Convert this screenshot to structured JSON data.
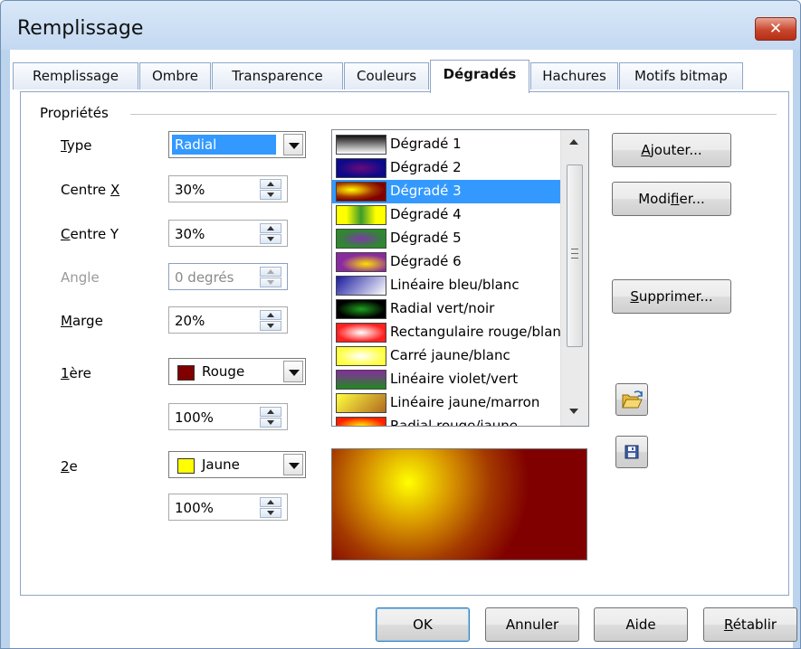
{
  "window": {
    "title": "Remplissage",
    "close_label": "✕"
  },
  "tabs": [
    {
      "label": "Remplissage"
    },
    {
      "label": "Ombre"
    },
    {
      "label": "Transparence"
    },
    {
      "label": "Couleurs"
    },
    {
      "label": "Dégradés",
      "active": true
    },
    {
      "label": "Hachures"
    },
    {
      "label": "Motifs bitmap"
    }
  ],
  "properties": {
    "group_label": "Propriétés",
    "type": {
      "label_pre": "",
      "label_u": "T",
      "label_post": "ype",
      "value": "Radial"
    },
    "centre_x": {
      "label_pre": "Centre ",
      "label_u": "X",
      "label_post": "",
      "value": "30%"
    },
    "centre_y": {
      "label_pre": "",
      "label_u": "C",
      "label_post": "entre Y",
      "value": "30%"
    },
    "angle": {
      "label": "Angle",
      "value": "0 degrés",
      "disabled": true
    },
    "marge": {
      "label_pre": "",
      "label_u": "M",
      "label_post": "arge",
      "value": "20%"
    },
    "first": {
      "label_pre": "",
      "label_u": "1",
      "label_post": "ère",
      "color_name": "Rouge",
      "color": "#800000",
      "intensity": "100%"
    },
    "second": {
      "label_pre": "",
      "label_u": "2",
      "label_post": "e",
      "color_name": "Jaune",
      "color": "#ffff00",
      "intensity": "100%"
    }
  },
  "gradients": [
    {
      "name": "Dégradé 1",
      "swatch": "linear-gradient(#111,#888 50%,#fff)"
    },
    {
      "name": "Dégradé 2",
      "swatch": "radial-gradient(ellipse at center,#6a0a7a,#0a0a8a 70%)"
    },
    {
      "name": "Dégradé 3",
      "swatch": "radial-gradient(ellipse at 30% 40%,#ffff00,#d89500 25%,#a43a00 45%,#800000 70%)",
      "selected": true
    },
    {
      "name": "Dégradé 4",
      "swatch": "linear-gradient(90deg,#ffff00 20%,#3c9a2a 50%,#ffff00 80%)"
    },
    {
      "name": "Dégradé 5",
      "swatch": "radial-gradient(ellipse at center,#7c3aa8,#2d8a2d 70%)"
    },
    {
      "name": "Dégradé 6",
      "swatch": "radial-gradient(ellipse at 60% 60%,#ffe000,#8a2aa0 60%)"
    },
    {
      "name": "Linéaire bleu/blanc",
      "swatch": "linear-gradient(135deg,#1a1aa0,#ffffff)"
    },
    {
      "name": "Radial vert/noir",
      "swatch": "radial-gradient(ellipse at center,#1ea01e,#000000 70%)"
    },
    {
      "name": "Rectangulaire rouge/blanc",
      "swatch": "radial-gradient(ellipse at center,#ffffff,#ff2020 70%)"
    },
    {
      "name": "Carré jaune/blanc",
      "swatch": "radial-gradient(ellipse at center,#ffffff,#ffff40 70%)"
    },
    {
      "name": "Linéaire violet/vert",
      "swatch": "linear-gradient(#8a2aa0,#1e8a1e)"
    },
    {
      "name": "Linéaire jaune/marron",
      "swatch": "linear-gradient(135deg,#ffff40,#b06a20)"
    },
    {
      "name": "Radial rouge/jaune",
      "swatch": "radial-gradient(ellipse at center,#ffff00,#ff2000 70%)"
    }
  ],
  "buttons": {
    "ajouter": {
      "pre": "",
      "u": "A",
      "post": "jouter..."
    },
    "modifier": {
      "pre": "Modi",
      "u": "f",
      "post": "ier..."
    },
    "supprimer": {
      "pre": "",
      "u": "S",
      "post": "upprimer..."
    },
    "ok": "OK",
    "annuler": "Annuler",
    "aide": "Aide",
    "retablir": {
      "pre": "",
      "u": "R",
      "post": "établir"
    }
  },
  "icons": {
    "open": "folder-open-icon",
    "save": "floppy-save-icon"
  }
}
